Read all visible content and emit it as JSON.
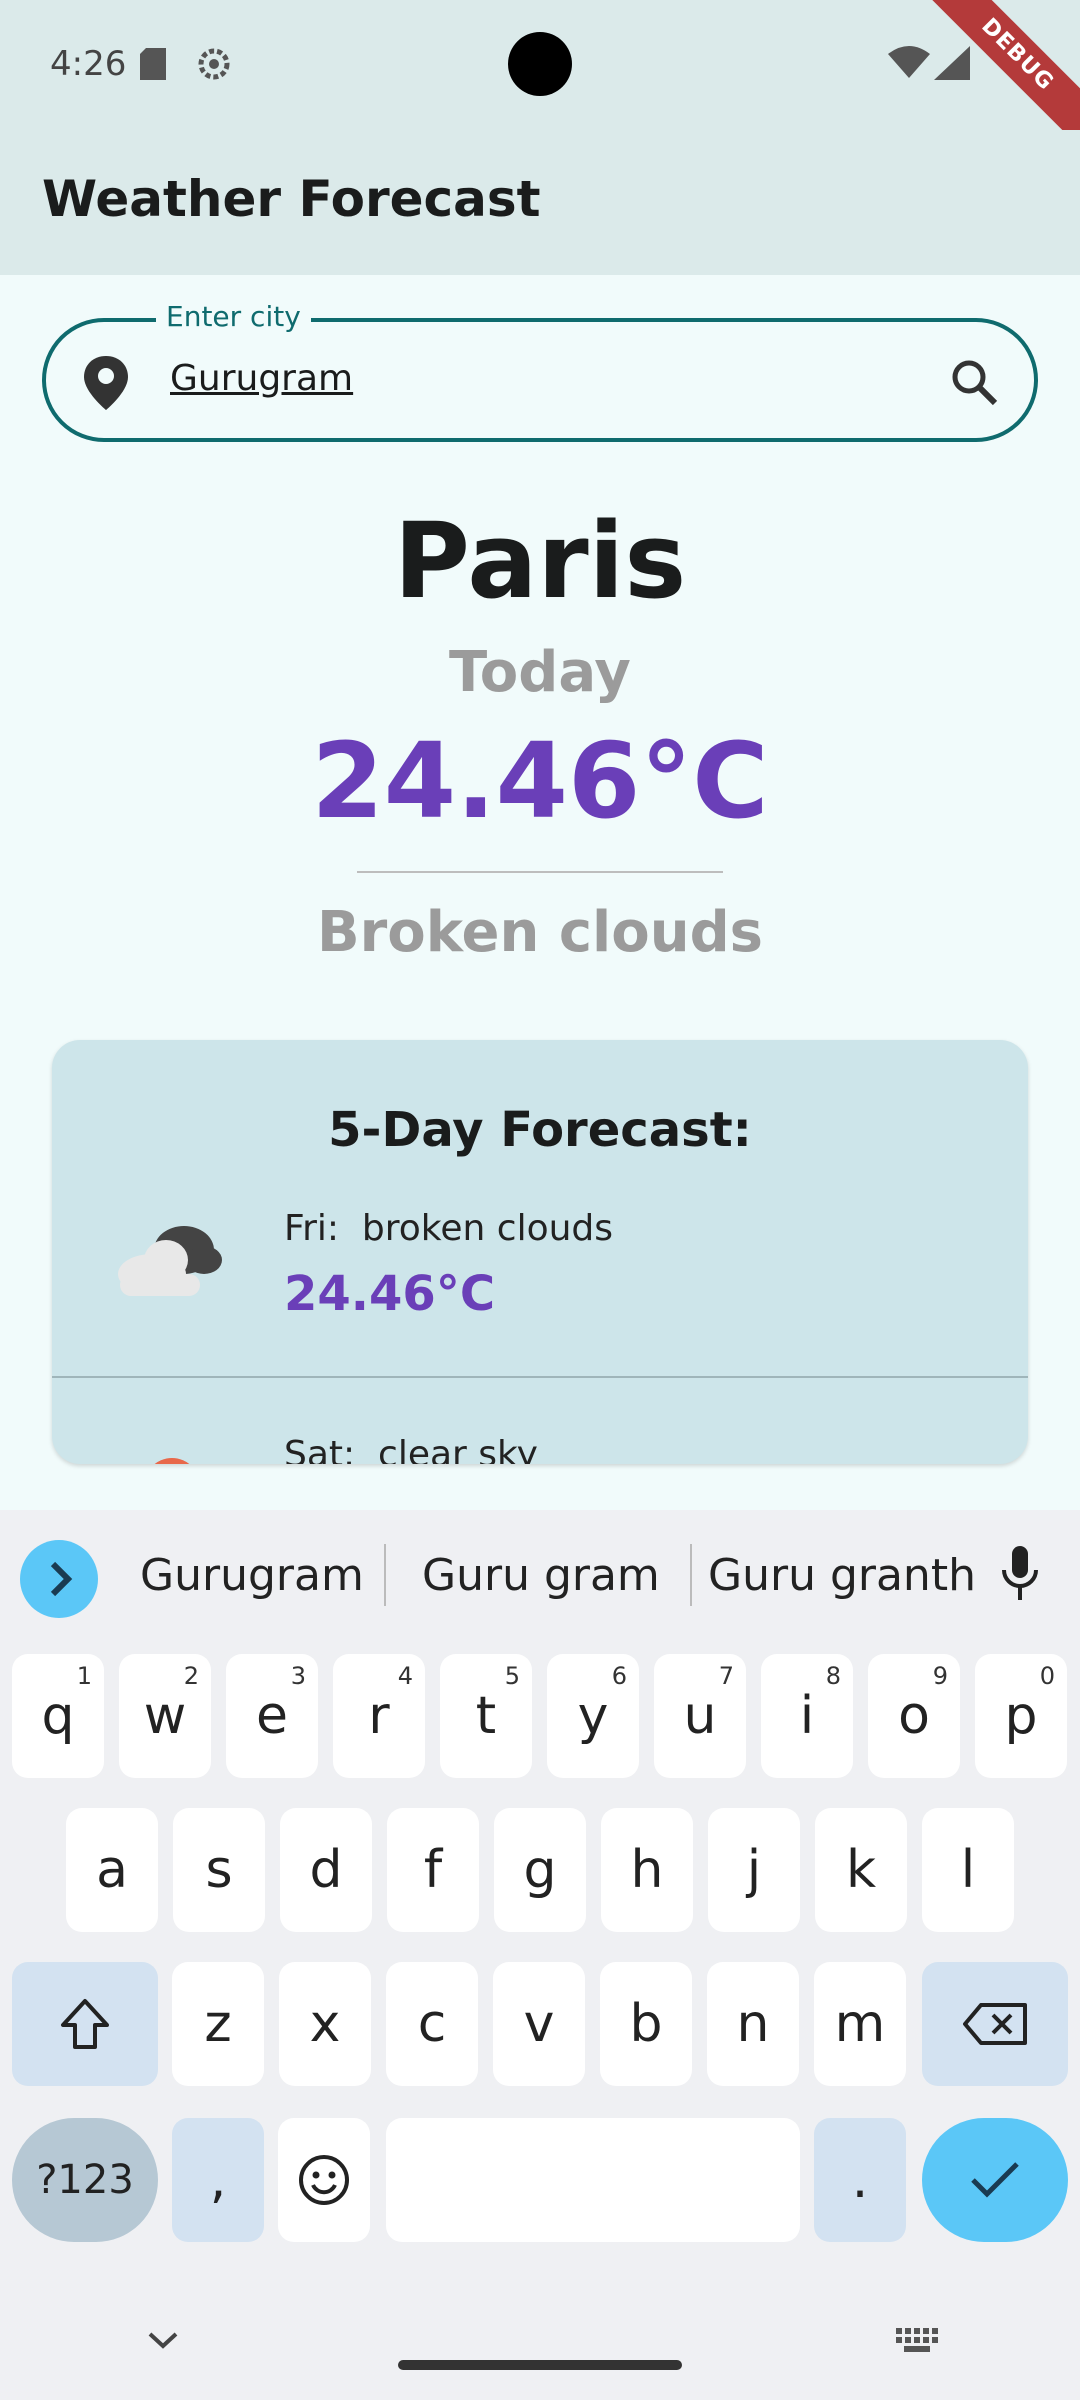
{
  "status": {
    "time": "4:26"
  },
  "debug_label": "DEBUG",
  "appbar": {
    "title": "Weather Forecast"
  },
  "search": {
    "label": "Enter city",
    "value": "Gurugram"
  },
  "current": {
    "city": "Paris",
    "day": "Today",
    "temperature": "24.46°C",
    "description": "Broken clouds"
  },
  "forecast": {
    "title": "5-Day Forecast:",
    "rows": [
      {
        "day": "Fri:",
        "description": "broken clouds",
        "temperature": "24.46°C",
        "icon": "broken-clouds-icon"
      },
      {
        "day": "Sat:",
        "description": "clear sky",
        "icon": "sun-icon"
      }
    ]
  },
  "keyboard": {
    "suggestions": [
      "Gurugram",
      "Guru gram",
      "Guru granth"
    ],
    "row1": [
      {
        "k": "q",
        "n": "1"
      },
      {
        "k": "w",
        "n": "2"
      },
      {
        "k": "e",
        "n": "3"
      },
      {
        "k": "r",
        "n": "4"
      },
      {
        "k": "t",
        "n": "5"
      },
      {
        "k": "y",
        "n": "6"
      },
      {
        "k": "u",
        "n": "7"
      },
      {
        "k": "i",
        "n": "8"
      },
      {
        "k": "o",
        "n": "9"
      },
      {
        "k": "p",
        "n": "0"
      }
    ],
    "row2": [
      "a",
      "s",
      "d",
      "f",
      "g",
      "h",
      "j",
      "k",
      "l"
    ],
    "row3": [
      "z",
      "x",
      "c",
      "v",
      "b",
      "n",
      "m"
    ],
    "sym_label": "?123",
    "comma": ",",
    "period": "."
  },
  "colors": {
    "accent": "#0f6b6e",
    "temperature": "#6a3fb8",
    "card": "#cde5ea",
    "appbar": "#dbeaea"
  }
}
